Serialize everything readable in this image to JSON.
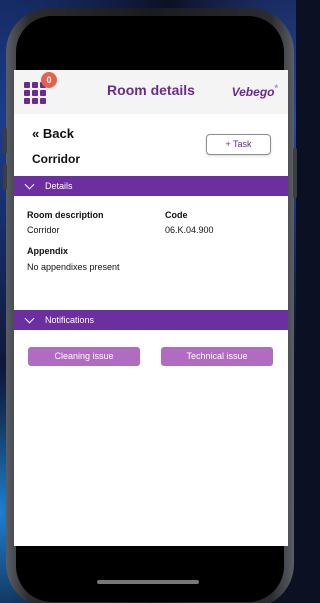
{
  "header": {
    "badge_count": "0",
    "title": "Room details",
    "logo": "Vebego",
    "logo_mark": "*"
  },
  "nav": {
    "back_label": "« Back",
    "task_button_label": "+ Task"
  },
  "room": {
    "name": "Corridor"
  },
  "details": {
    "section_label": "Details",
    "description_label": "Room description",
    "description_value": "Corridor",
    "code_label": "Code",
    "code_value": "06.K.04.900",
    "appendix_label": "Appendix",
    "appendix_value": "No appendixes present"
  },
  "notifications": {
    "section_label": "Notifications",
    "cleaning_label": "Cleaning issue",
    "technical_label": "Technical issue"
  },
  "colors": {
    "brand_purple": "#6b2fa0",
    "button_lilac": "#b06cc0",
    "badge_orange": "#e8604c"
  }
}
